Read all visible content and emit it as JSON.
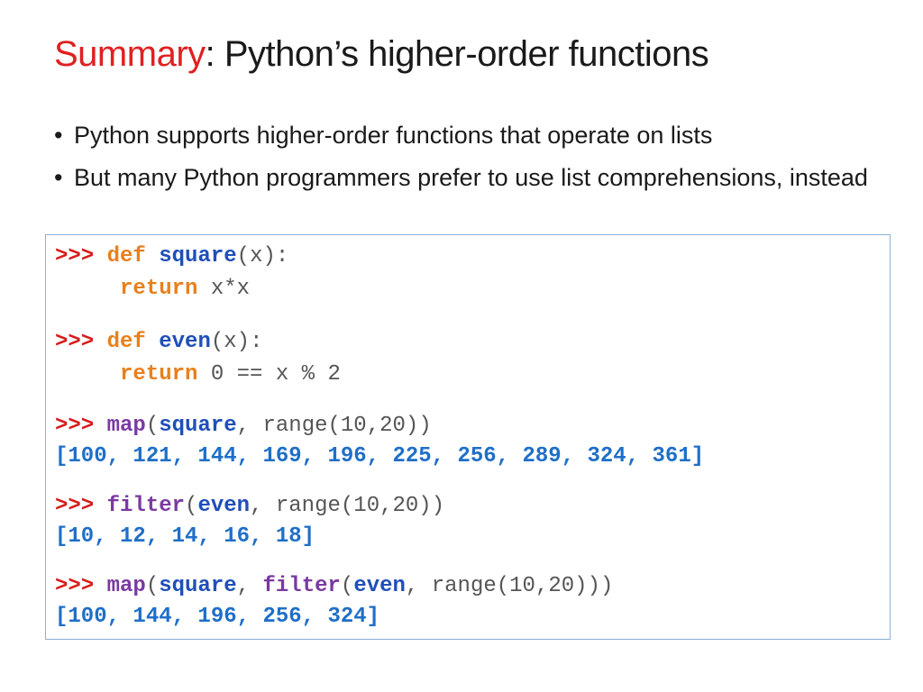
{
  "title": {
    "accent": "Summary",
    "rest": ": Python’s higher-order functions"
  },
  "bullets": [
    "Python supports higher-order functions that operate on lists",
    "But many Python programmers prefer to use list comprehensions, instead"
  ],
  "bullet_glyph": "•",
  "code": {
    "prompt": ">>>",
    "def_kw": "def",
    "return_kw": "return",
    "square": "square",
    "even": "even",
    "paren_x": "(x):",
    "x_times_x": "x*x",
    "zero_mod": "0 == x % 2",
    "map": "map",
    "filter": "filter",
    "open_paren": "(",
    "comma": ",",
    "range_call_2": "range(10,20))",
    "range_call_3": "range(10,20)))",
    "output_map": "[100, 121, 144, 169, 196, 225, 256, 289, 324, 361]",
    "output_filter": "[10, 12, 14, 16, 18]",
    "output_combined": "[100, 144, 196, 256, 324]"
  },
  "colors": {
    "accent_red": "#e02020",
    "prompt": "#d81b1b",
    "keyword": "#e8801c",
    "function_name": "#1f4fb8",
    "builtin": "#7a3aa0",
    "output": "#1f6fc8",
    "box_border": "#8ab0d8"
  }
}
